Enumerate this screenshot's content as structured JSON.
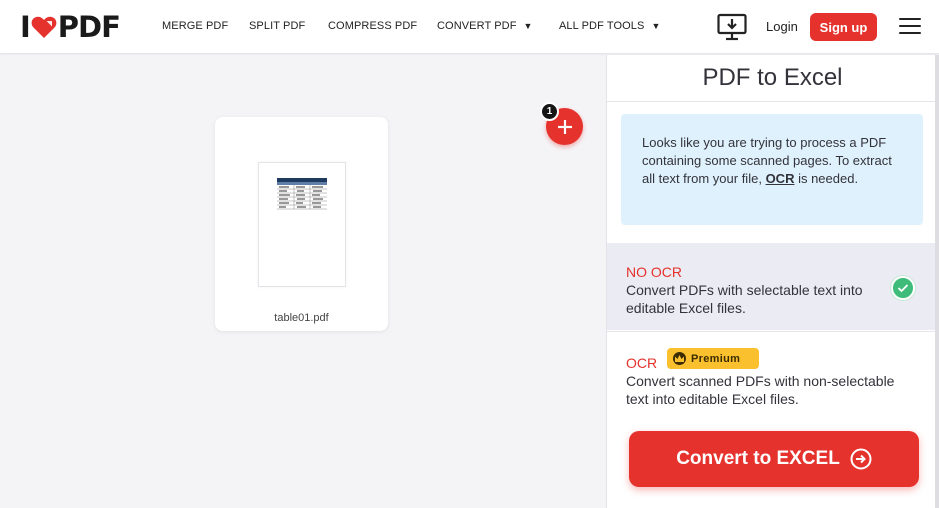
{
  "header": {
    "logo_left": "I",
    "logo_right": "PDF",
    "nav": [
      {
        "label": "MERGE PDF"
      },
      {
        "label": "SPLIT PDF"
      },
      {
        "label": "COMPRESS PDF"
      },
      {
        "label": "CONVERT PDF"
      },
      {
        "label": "ALL PDF TOOLS"
      }
    ],
    "login": "Login",
    "signup": "Sign up"
  },
  "workspace": {
    "file_name": "table01.pdf",
    "file_count": "1"
  },
  "sidebar": {
    "title": "PDF to Excel",
    "info_text": "Looks like you are trying to process a PDF containing some scanned pages. To extract all text from your file,",
    "info_link": "OCR",
    "info_tail": "is needed.",
    "options": [
      {
        "title": "NO OCR",
        "desc": "Convert PDFs with selectable text into editable Excel files."
      },
      {
        "title": "OCR",
        "desc": "Convert scanned PDFs with non-selectable text into editable Excel files.",
        "badge": "Premium"
      }
    ],
    "convert_label": "Convert to EXCEL"
  },
  "colors": {
    "brand_red": "#e5322d",
    "info_bg": "#dff1fc",
    "selected_bg": "#ebebf3",
    "check_green": "#3fbc7a",
    "premium_yellow": "#fbc02d"
  },
  "icons": [
    "heart-logo-icon",
    "caret-down-icon",
    "download-desktop-icon",
    "hamburger-menu-icon",
    "plus-icon",
    "check-icon",
    "crown-icon",
    "arrow-right-circle-icon"
  ]
}
